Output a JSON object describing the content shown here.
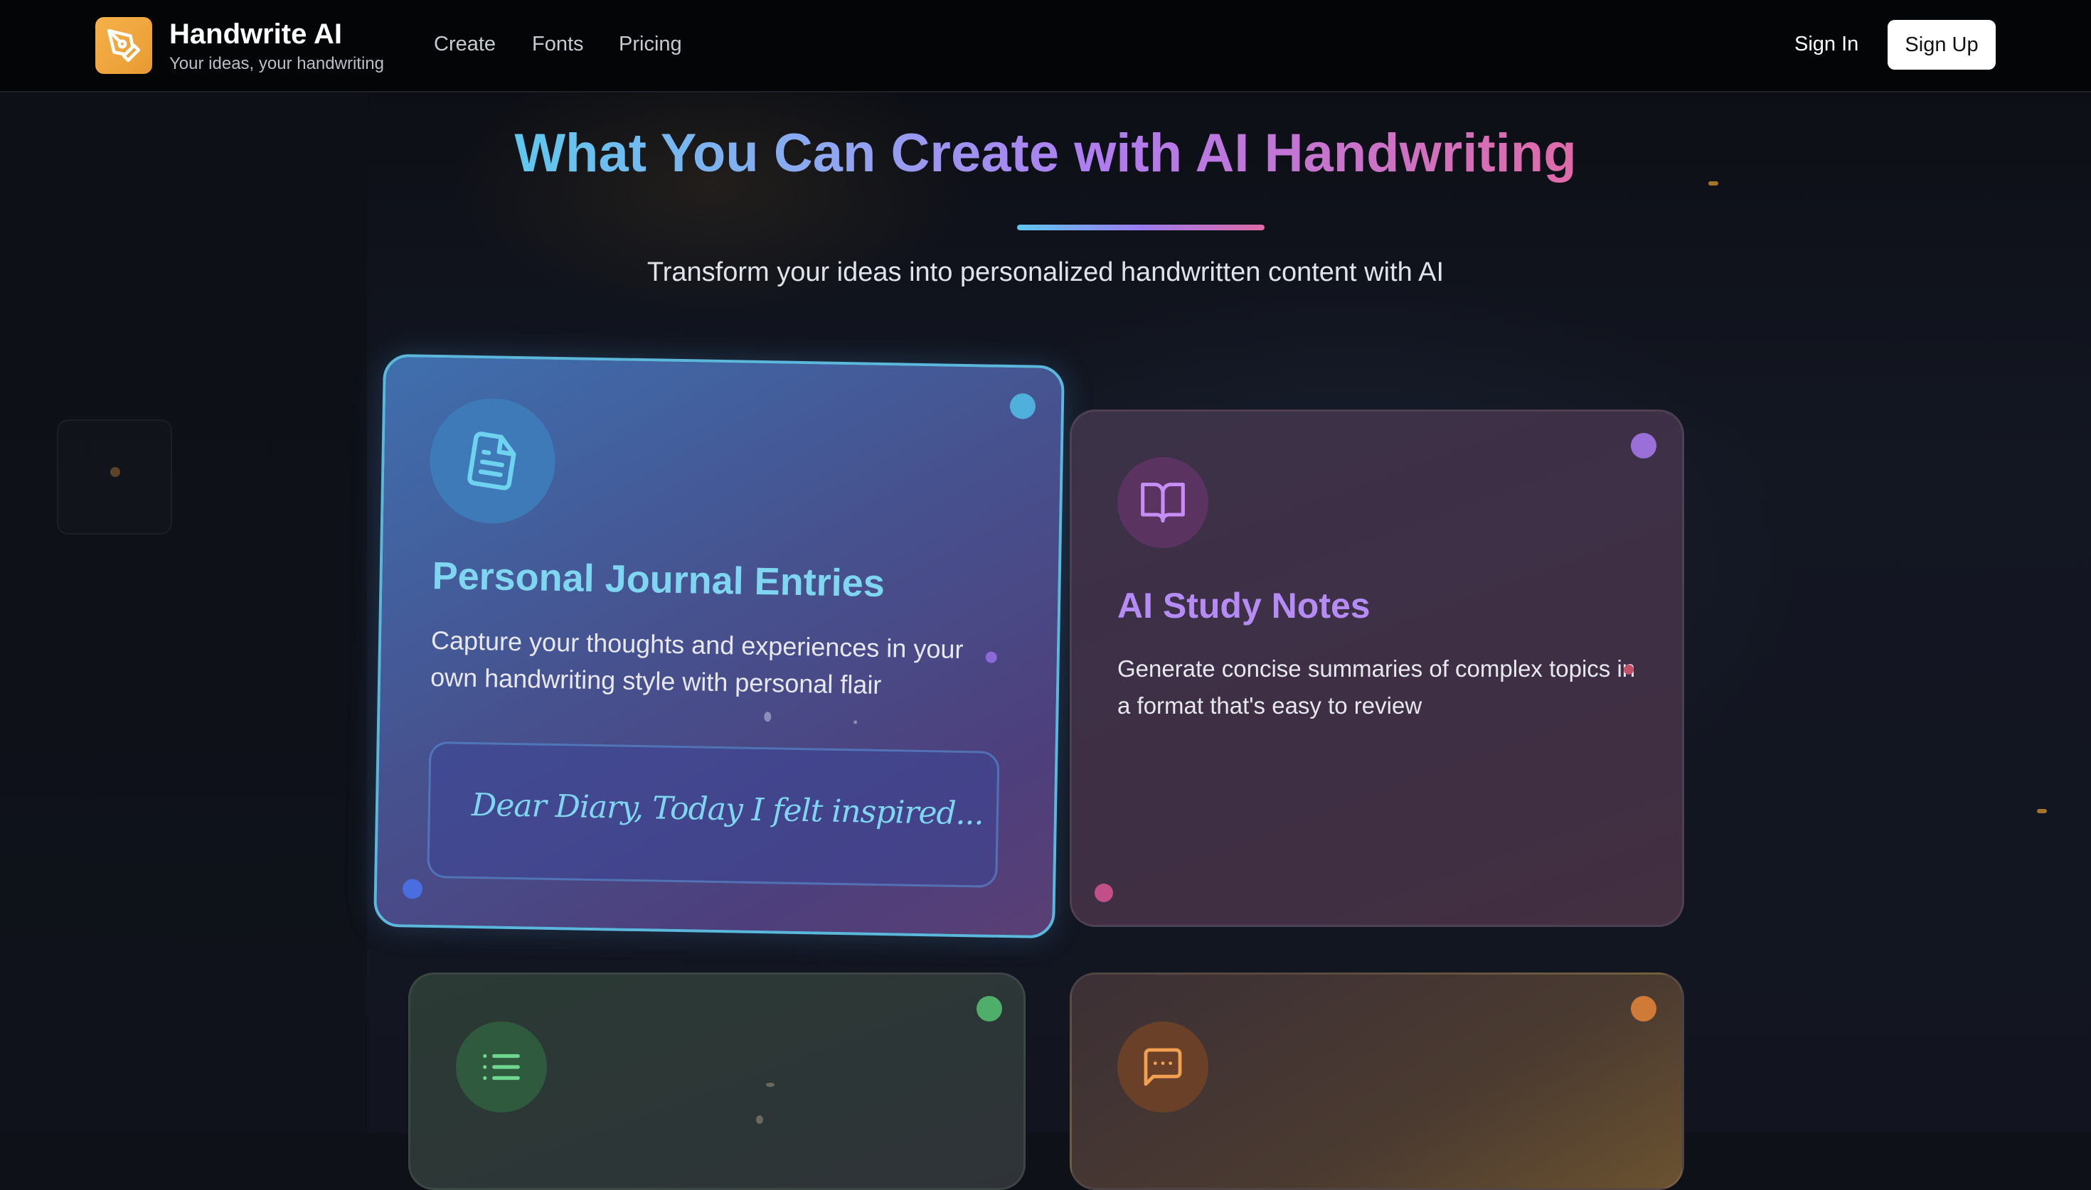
{
  "brand": {
    "name": "Handwrite AI",
    "tagline": "Your ideas, your handwriting"
  },
  "nav": {
    "links": [
      "Create",
      "Fonts",
      "Pricing"
    ],
    "sign_in": "Sign In",
    "sign_up": "Sign Up"
  },
  "hero": {
    "title": "What You Can Create with AI Handwriting",
    "subtitle": "Transform your ideas into personalized handwritten content with AI"
  },
  "cards": [
    {
      "title": "Personal Journal Entries",
      "description": "Capture your thoughts and experiences in your own handwriting style with personal flair",
      "sample": "Dear Diary, Today I felt inspired...",
      "icon": "document-icon",
      "accent": "#7fd6f0"
    },
    {
      "title": "AI Study Notes",
      "description": "Generate concise summaries of complex topics in a format that's easy to review",
      "icon": "book-open-icon",
      "accent": "#b58cf5"
    },
    {
      "title": "",
      "icon": "list-icon",
      "accent": "#6fd690"
    },
    {
      "title": "",
      "icon": "chat-icon",
      "accent": "#f0a050"
    }
  ],
  "colors": {
    "logo_bg": "#f0a53c",
    "page_bg": "#0f1118",
    "nav_bg": "#040506"
  }
}
